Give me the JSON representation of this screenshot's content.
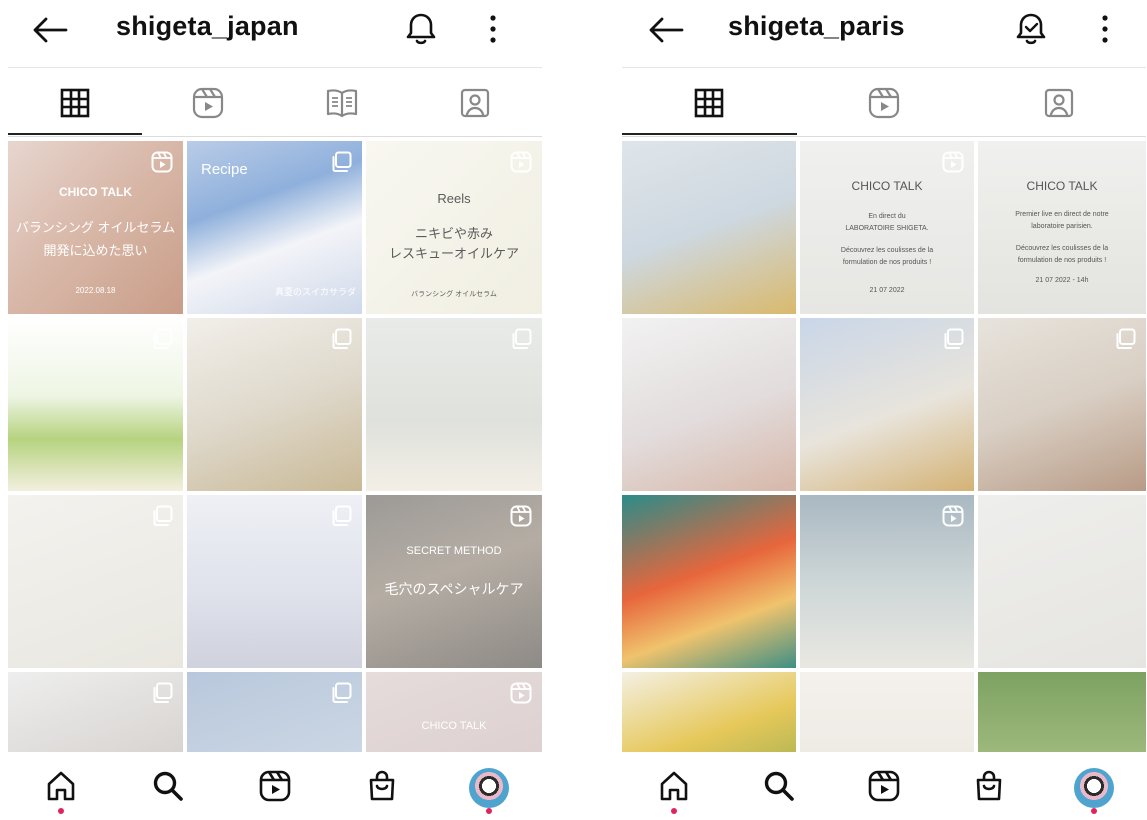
{
  "left": {
    "title": "shigeta_japan",
    "tiles": [
      {
        "name": "tile-chico-talk-oil",
        "bg": "linear-gradient(135deg,#e7d6cf 0%,#d9b9aa 45%,#c99d88 100%)",
        "badge": "reels",
        "lines": [
          "CHICO TALK",
          "バランシング オイルセラム",
          "開発に込めた思い",
          "2022.08.18"
        ]
      },
      {
        "name": "tile-recipe-watermelon",
        "bg": "linear-gradient(160deg,#b9cce7 0%,#8fb0dc 35%,#f3f4f8 60%,#cfd9ea 100%)",
        "badge": "carousel",
        "lines": [
          "Recipe",
          "真夏のスイカサラダ"
        ]
      },
      {
        "name": "tile-reels-oilcare",
        "bg": "linear-gradient(135deg,#f8f7f0 0%,#f1efe2 100%)",
        "badge": "reels",
        "lines": [
          "Reels",
          "ニキビや赤み",
          "レスキューオイルケア",
          "バランシング オイルセラム"
        ]
      },
      {
        "name": "tile-flowers-oil",
        "bg": "linear-gradient(180deg,#ffffff 0%,#eef5e4 45%,#b6d37f 70%,#f3efe0 100%)",
        "badge": "carousel",
        "lines": []
      },
      {
        "name": "tile-straw-hat-bag",
        "bg": "linear-gradient(160deg,#f2efea 0%,#dfd9cc 50%,#c9b996 100%)",
        "badge": "carousel",
        "lines": []
      },
      {
        "name": "tile-bottles-beige",
        "bg": "linear-gradient(180deg,#e9ebe9 0%,#dfe1dc 60%,#f3efe6 100%)",
        "badge": "carousel",
        "lines": []
      },
      {
        "name": "tile-dropper",
        "bg": "linear-gradient(160deg,#f3f2ee 0%,#e9e7e0 100%)",
        "badge": "carousel",
        "lines": []
      },
      {
        "name": "tile-purple-bottles",
        "bg": "linear-gradient(180deg,#eef0f5 0%,#e0e2ec 55%,#cfd1dc 100%)",
        "badge": "carousel",
        "lines": []
      },
      {
        "name": "tile-secret-method",
        "bg": "linear-gradient(160deg,#9c9a97 0%,#b5ada4 45%,#8e8a86 100%)",
        "badge": "reels",
        "lines": [
          "SECRET METHOD",
          "毛穴のスペシャルケア"
        ]
      },
      {
        "name": "tile-woman-drinking",
        "bg": "linear-gradient(160deg,#eeeeee 0%,#d8d4d1 60%,#bcb6b2 100%)",
        "badge": "carousel",
        "lines": []
      },
      {
        "name": "tile-hands-soap",
        "bg": "linear-gradient(160deg,#b8c8dc 0%,#cbd6e4 60%,#a89cc8 100%)",
        "badge": "carousel",
        "lines": []
      },
      {
        "name": "tile-chico-talk-2",
        "bg": "linear-gradient(160deg,#e6dcdc 0%,#d7c9c9 100%)",
        "badge": "reels",
        "lines": [
          "CHICO TALK"
        ]
      }
    ]
  },
  "right": {
    "title": "shigeta_paris",
    "tiles": [
      {
        "name": "tile-pouch-sunglasses",
        "bg": "linear-gradient(160deg,#dfe5ea 0%,#ced8e0 50%,#d9b96d 100%)",
        "badge": "",
        "lines": []
      },
      {
        "name": "tile-chico-talk-fr",
        "bg": "linear-gradient(180deg,#f0f0ee 0%,#e6e6e3 100%)",
        "badge": "reels",
        "lines": [
          "CHICO TALK",
          "En direct du",
          "LABORATOIRE SHIGETA.",
          "Découvrez les coulisses de la",
          "formulation de nos produits !",
          "21 07 2022"
        ]
      },
      {
        "name": "tile-chico-talk-fr-2",
        "bg": "linear-gradient(180deg,#f0f0ee 0%,#e3e3df 100%)",
        "badge": "",
        "lines": [
          "CHICO TALK",
          "Premier live en direct de notre",
          "laboratoire parisien.",
          "Découvrez les coulisses de la",
          "formulation de nos produits !",
          "21 07 2022 - 14h"
        ]
      },
      {
        "name": "tile-hands-tube",
        "bg": "linear-gradient(160deg,#f2f2f2 0%,#e2dcdc 55%,#d7b7a8 100%)",
        "badge": "",
        "lines": []
      },
      {
        "name": "tile-pouch-birds",
        "bg": "linear-gradient(160deg,#c9d6e8 0%,#e8e4dc 55%,#d4b274 100%)",
        "badge": "carousel",
        "lines": []
      },
      {
        "name": "tile-woman-bottle",
        "bg": "linear-gradient(160deg,#e7e3dc 0%,#d9cfc4 50%,#b89b86 100%)",
        "badge": "carousel",
        "lines": []
      },
      {
        "name": "tile-towel-hat",
        "bg": "linear-gradient(160deg,#2b8c8a 0%,#e7663c 45%,#f0c36d 70%,#3f8f84 100%)",
        "badge": "",
        "lines": []
      },
      {
        "name": "tile-lab-microscope",
        "bg": "linear-gradient(180deg,#a9b8c2 0%,#cdd6d7 50%,#e9e8e2 100%)",
        "badge": "reels",
        "lines": []
      },
      {
        "name": "tile-lavender",
        "bg": "linear-gradient(160deg,#eeeeec 0%,#e6e5e1 100%)",
        "badge": "",
        "lines": []
      },
      {
        "name": "tile-salad",
        "bg": "linear-gradient(160deg,#f4f0e4 0%,#e6c85a 40%,#6d9c4a 100%)",
        "badge": "",
        "lines": []
      },
      {
        "name": "tile-white-room",
        "bg": "linear-gradient(180deg,#f4f1ec 0%,#e8e4dd 100%)",
        "badge": "",
        "lines": []
      },
      {
        "name": "tile-garden",
        "bg": "linear-gradient(180deg,#7da262 0%,#9fba7e 50%,#c3c7a9 100%)",
        "badge": "",
        "lines": []
      }
    ]
  },
  "colors": {
    "dot": "#e0245e",
    "overlay_text": "#ffffff",
    "reels_text": "#5b5b5b"
  }
}
